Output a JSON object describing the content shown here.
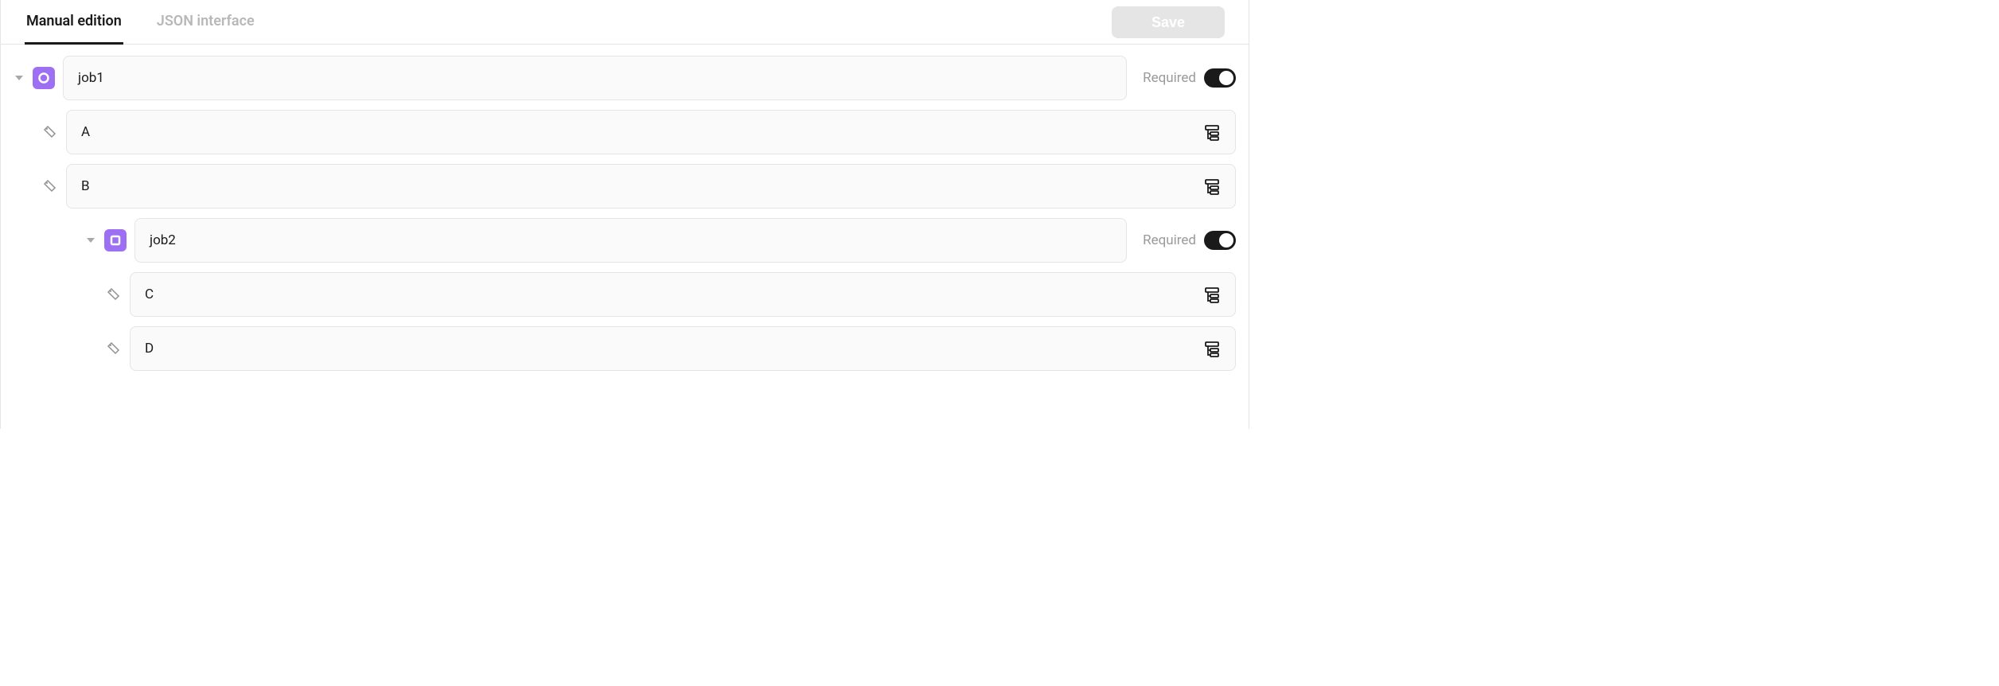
{
  "tabs": {
    "manual": "Manual edition",
    "json": "JSON interface"
  },
  "actions": {
    "save": "Save"
  },
  "toggle_label": "Required",
  "rows": {
    "job1": {
      "value": "job1"
    },
    "a": {
      "value": "A"
    },
    "b": {
      "value": "B"
    },
    "job2": {
      "value": "job2"
    },
    "c": {
      "value": "C"
    },
    "d": {
      "value": "D"
    }
  }
}
